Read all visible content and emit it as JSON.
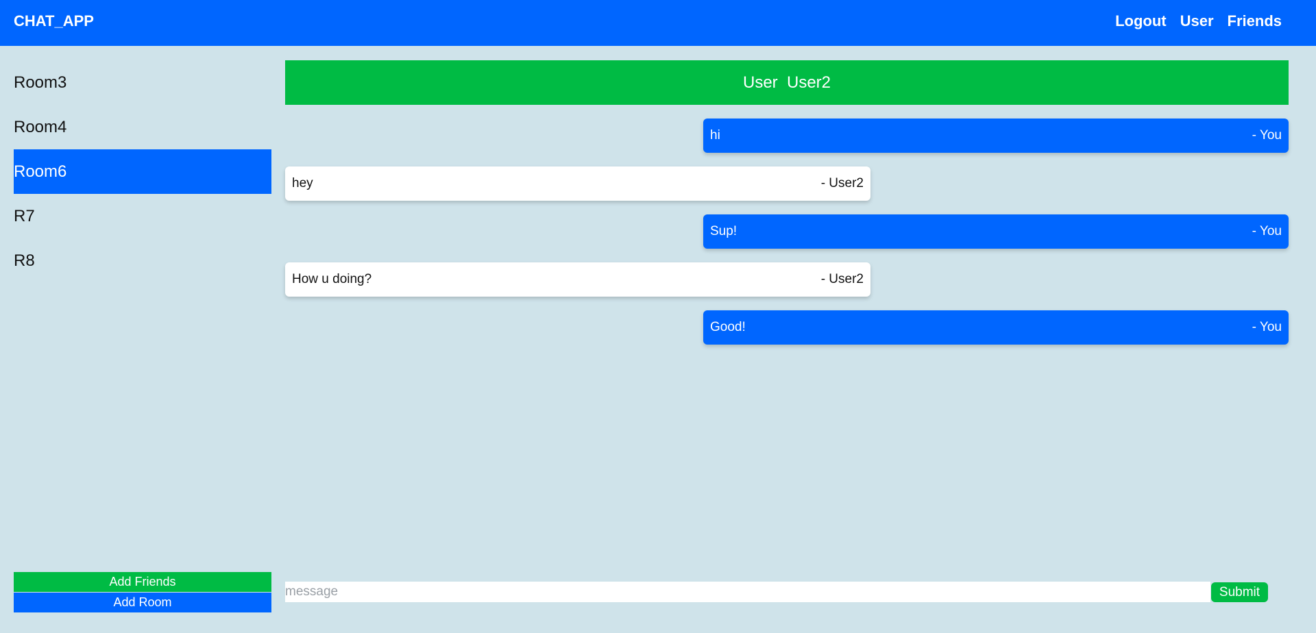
{
  "navbar": {
    "brand": "CHAT_APP",
    "links": [
      "Logout",
      "User",
      "Friends"
    ]
  },
  "sidebar": {
    "rooms": [
      "Room3",
      "Room4",
      "Room6",
      "R7",
      "R8"
    ],
    "active_room": "Room6",
    "add_friends_label": "Add Friends",
    "add_room_label": "Add Room"
  },
  "chat": {
    "header": "User  User2",
    "messages": [
      {
        "text": "hi",
        "author": "- You",
        "mine": true
      },
      {
        "text": "hey",
        "author": "- User2",
        "mine": false
      },
      {
        "text": "Sup!",
        "author": "- You",
        "mine": true
      },
      {
        "text": "How u doing?",
        "author": "- User2",
        "mine": false
      },
      {
        "text": "Good!",
        "author": "- You",
        "mine": true
      }
    ],
    "composer_placeholder": "message",
    "composer_value": "",
    "submit_label": "Submit"
  },
  "colors": {
    "primary": "#0066ff",
    "success": "#00bb44",
    "background": "#cfe3ea"
  }
}
